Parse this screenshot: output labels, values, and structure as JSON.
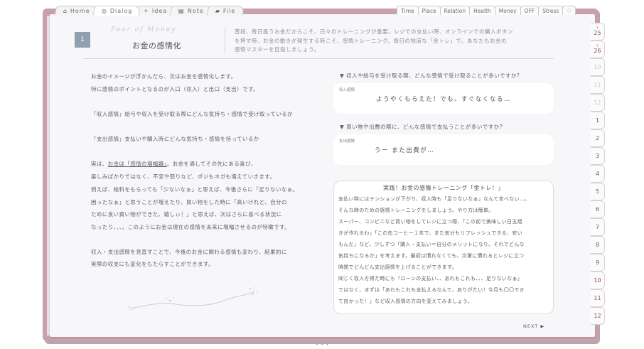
{
  "tabs_left": [
    {
      "label": "Home",
      "icon": "house-icon",
      "glyph": "⌂"
    },
    {
      "label": "Dialog",
      "icon": "target-icon",
      "glyph": "◎"
    },
    {
      "label": "Idea",
      "icon": "lightbulb-icon",
      "glyph": "✧"
    },
    {
      "label": "Note",
      "icon": "notepad-icon",
      "glyph": "▤"
    },
    {
      "label": "File",
      "icon": "folder-icon",
      "glyph": "▰"
    }
  ],
  "tabs_right": [
    "Time",
    "Place",
    "Relation",
    "Health",
    "Money",
    "OFF",
    "Stress"
  ],
  "tabs_right_heart_icon": "heart-icon",
  "index_tabs": [
    {
      "sup": "Y",
      "label": "25",
      "style": "month"
    },
    {
      "sup": "Y",
      "label": "26",
      "style": "month"
    },
    {
      "sup": "",
      "label": "10",
      "style": "muted"
    },
    {
      "sup": "",
      "label": "11",
      "style": "muted"
    },
    {
      "sup": "",
      "label": "12",
      "style": "muted"
    },
    {
      "sup": "",
      "label": "1",
      "style": "month"
    },
    {
      "sup": "",
      "label": "2",
      "style": "month"
    },
    {
      "sup": "",
      "label": "3",
      "style": "month"
    },
    {
      "sup": "",
      "label": "4",
      "style": "month"
    },
    {
      "sup": "",
      "label": "5",
      "style": "month"
    },
    {
      "sup": "",
      "label": "6",
      "style": "month"
    },
    {
      "sup": "",
      "label": "7",
      "style": "month"
    },
    {
      "sup": "",
      "label": "8",
      "style": "month"
    },
    {
      "sup": "",
      "label": "9",
      "style": "month"
    },
    {
      "sup": "",
      "label": "10",
      "style": "month"
    },
    {
      "sup": "",
      "label": "11",
      "style": "month"
    },
    {
      "sup": "",
      "label": "12",
      "style": "month"
    }
  ],
  "header": {
    "number": "1",
    "script_title": "Fear of Money",
    "title": "お金の感情化",
    "description_lines": [
      "普段、毎日扱うお金だからこそ、日々のトレーニングが重要。レジでの支払い時、オンラインでの購入ボタン",
      "を押す時、お金の動きが発生する時こそ、感情トレーニング。毎日の地道な「金トレ」で、あなたもお金の",
      "感情マスターを目指しましょう。"
    ]
  },
  "left_body": {
    "p1_line1": "お金のイメージが浮かんだら、次はお金を感情化します。",
    "p1_line2": "特に感情のポイントとなるのが入口（収入）と出口（支出）です。",
    "p2": "「収入感情」給与や収入を受け取る際にどんな気持ち・感情で受け取っているか",
    "p3": "「支出感情」支払いや購入時にどんな気持ち・感情を持っているか",
    "p4_line1_pre": "実は、",
    "p4_line1_u": "お金は「感情の増幅器」",
    "p4_line1_post": "。お金を通してその先にある喜び、",
    "p4_line2": "楽しみばかりではなく、不安や怒りなど、ポジもネガも増えていきます。",
    "p4_line3": "例えば、給料をもらっても「少ないなぁ」と思えば、今後さらに「足りないなぁ。",
    "p4_line4": "困ったなぁ」と思うことが増えたり、買い物をした時に「高いけれど、自分の",
    "p4_line5": "ために良い買い物ができた、嬉しぃ！」と思えば、次はさらに喜べる状況に",
    "p4_line6": "なったり、、、。このようにお金は現在の感情を未来に増幅させるのが特徴です。",
    "p5_line1": "収入・支出感情を見直すことで、今後のお金に関わる感情も変わり、結果的に",
    "p5_line2": "実際の収支にも変化をもたらすことができます。"
  },
  "right_body": {
    "q1": "▼ 収入や給与を受け取る際、どんな感情で受け取ることが多いですか？",
    "a1_label": "収入感情",
    "a1_text": "ようやくもらえた！でも、すぐなくなる…",
    "q2": "▼ 買い物や出費の際に、どんな感情で支払うことが多いですか？",
    "a2_label": "支出感情",
    "a2_text": "うー また出費が…",
    "practice_title": "実践！お金の感情トレーニング「金トレ！」",
    "practice_lines": [
      "支払い時にはテンションが下がり、収入時も「足りないなぁ」なんて言べない…。",
      "そんな時のための感情トレーニングをしましょう。やり方は簡単。",
      "スーパー、コンビニなど買い物をしてレジに立つ際、「この前で美味しい日玉焼",
      "きが作れるわ」「この缶コーヒー１本で、また気分もリフレッシュできる、安い",
      "もんだ」など、少しずつ「購入・支払い＝自分のメリットになり、それでどんな",
      "気持ちになるか」を考えます。最初は慣れなくても、次第に慣れるとレジに立つ",
      "時間でどんどん支出感情を上げることができます。",
      "同じく収入を得た時にも「ローンの支払い、、あれもこれも、、、足りないなぁ」",
      "ではなく、まずは「あれもこれも支払えるなんて、ありがたい！今月も〇〇でき",
      "て良かった！」など収入感情の方向を変えてみましょう。"
    ]
  },
  "footer": {
    "next_label": "NEXT ▶",
    "dots": "• • •"
  }
}
